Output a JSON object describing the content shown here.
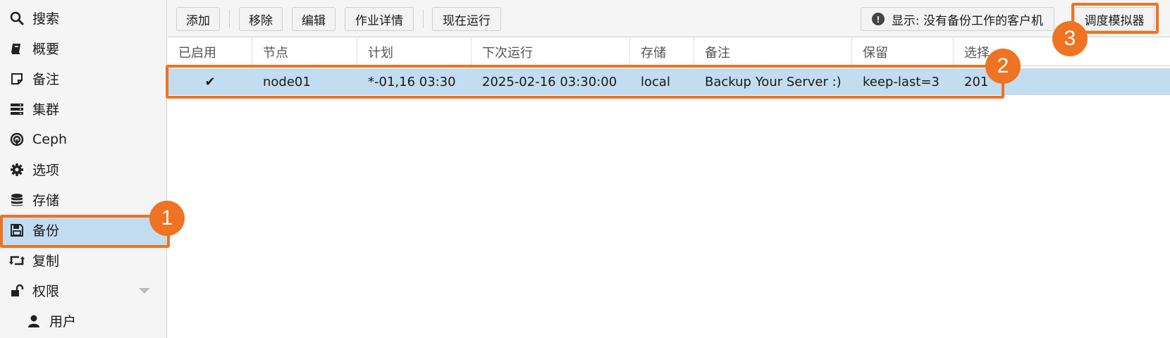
{
  "sidebar": {
    "items": [
      {
        "label": "搜索",
        "icon": "search-icon"
      },
      {
        "label": "概要",
        "icon": "book-icon"
      },
      {
        "label": "备注",
        "icon": "note-icon"
      },
      {
        "label": "集群",
        "icon": "server-icon"
      },
      {
        "label": "Ceph",
        "icon": "ceph-icon"
      },
      {
        "label": "选项",
        "icon": "gear-icon"
      },
      {
        "label": "存储",
        "icon": "database-icon"
      },
      {
        "label": "备份",
        "icon": "floppy-icon",
        "selected": true
      },
      {
        "label": "复制",
        "icon": "retweet-icon"
      },
      {
        "label": "权限",
        "icon": "unlock-icon",
        "expanded": true
      },
      {
        "label": "用户",
        "icon": "user-icon"
      }
    ]
  },
  "toolbar": {
    "add": "添加",
    "remove": "移除",
    "edit": "编辑",
    "job_detail": "作业详情",
    "run_now": "现在运行",
    "show_not_backed": "显示: 没有备份工作的客户机",
    "schedule_simulator": "调度模拟器"
  },
  "grid": {
    "columns": [
      "已启用",
      "节点",
      "计划",
      "下次运行",
      "存储",
      "备注",
      "保留",
      "选择"
    ],
    "rows": [
      {
        "enabled": "✔",
        "node": "node01",
        "schedule": "*-01,16 03:30",
        "next_run": "2025-02-16 03:30:00",
        "storage": "local",
        "comment": "Backup Your Server :)",
        "retention": "keep-last=3",
        "selection": "201"
      }
    ]
  },
  "annotations": {
    "badge1": "1",
    "badge2": "2",
    "badge3": "3",
    "color": "#ee7322"
  },
  "colors": {
    "selection": "#c2dcf0",
    "accent": "#ee7322"
  }
}
